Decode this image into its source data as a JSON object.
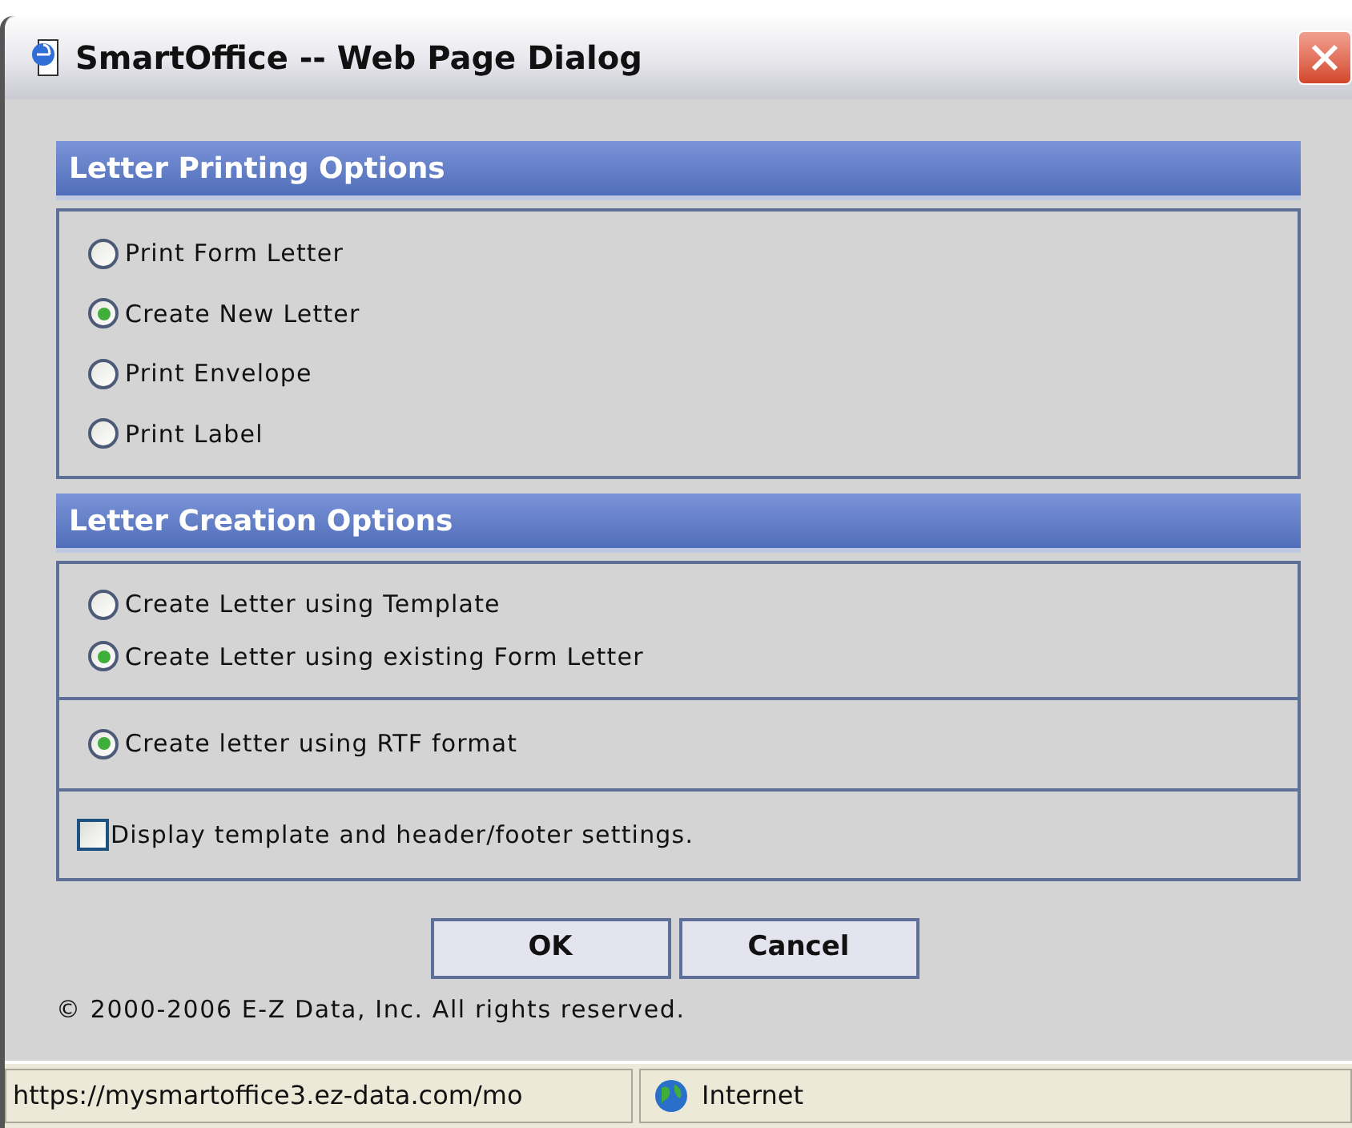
{
  "window": {
    "title": "SmartOffice -- Web Page Dialog"
  },
  "sections": [
    {
      "title": "Letter Printing Options",
      "groups": [
        {
          "kind": "radio",
          "items": [
            {
              "label": "Print Form Letter",
              "selected": false
            },
            {
              "label": "Create New Letter",
              "selected": true
            },
            {
              "label": "Print Envelope",
              "selected": false
            },
            {
              "label": "Print Label",
              "selected": false
            }
          ]
        }
      ]
    },
    {
      "title": "Letter Creation Options",
      "groups": [
        {
          "kind": "radio",
          "items": [
            {
              "label": "Create Letter using Template",
              "selected": false
            },
            {
              "label": "Create Letter using existing Form Letter",
              "selected": true
            }
          ]
        },
        {
          "kind": "radio",
          "items": [
            {
              "label": "Create letter using RTF format",
              "selected": true
            }
          ]
        },
        {
          "kind": "checkbox",
          "items": [
            {
              "label": "Display template and header/footer settings.",
              "checked": false
            }
          ]
        }
      ]
    }
  ],
  "buttons": [
    "OK",
    "Cancel"
  ],
  "copyright": "© 2000-2006 E-Z Data, Inc. All rights reserved.",
  "status_bar": {
    "url": "https://mysmartoffice3.ez-data.com/mo",
    "zone": "Internet"
  }
}
